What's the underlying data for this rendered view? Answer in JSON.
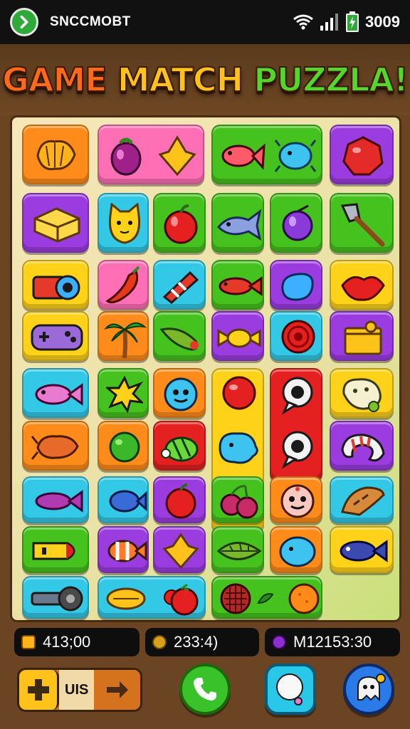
{
  "status_bar": {
    "carrier": "SNCCMOBT",
    "time": "3009"
  },
  "title": {
    "part1": "GAME ",
    "part2": "MATCH ",
    "part3": "PUZZLA!"
  },
  "scores": [
    {
      "value": "413;00",
      "gem_color": "#ffb21a"
    },
    {
      "value": "233:4)",
      "gem_color": "#d9a11a"
    },
    {
      "value": "M12153:30",
      "gem_color": "#8b2fd0"
    }
  ],
  "bottom_bar": {
    "combo_label": "UIS"
  },
  "colors": {
    "orange": "#ff8c1a",
    "pink": "#ff6fb6",
    "green": "#46c21f",
    "purple": "#9b3ce0",
    "cyan": "#33c9e6",
    "yellow": "#ffd21a",
    "red": "#e52020"
  },
  "board_tiles": [
    {
      "color": "orange",
      "item": "seashell-icon"
    },
    {
      "color": "pink",
      "item": "berry-icon"
    },
    {
      "color": "pink",
      "item": "star-gem-icon"
    },
    {
      "color": "green",
      "item": "fish-icon"
    },
    {
      "color": "green",
      "item": "pufferfish-icon"
    },
    {
      "color": "purple",
      "item": "red-gem-icon"
    },
    {
      "color": "purple",
      "item": "gold-block-icon"
    },
    {
      "color": "cyan",
      "item": "cat-face-icon"
    },
    {
      "color": "green",
      "item": "apple-icon"
    },
    {
      "color": "green",
      "item": "whale-icon"
    },
    {
      "color": "green",
      "item": "plum-icon"
    },
    {
      "color": "green",
      "item": "shovel-icon"
    },
    {
      "color": "yellow",
      "item": "camera-icon"
    },
    {
      "color": "pink",
      "item": "chili-icon"
    },
    {
      "color": "cyan",
      "item": "candy-stick-icon"
    },
    {
      "color": "green",
      "item": "fish-red-icon"
    },
    {
      "color": "purple",
      "item": "blue-bean-icon"
    },
    {
      "color": "yellow",
      "item": "red-lips-icon"
    },
    {
      "color": "yellow",
      "item": "gamepad-icon"
    },
    {
      "color": "orange",
      "item": "palm-tree-icon"
    },
    {
      "color": "green",
      "item": "cucumber-icon"
    },
    {
      "color": "purple",
      "item": "candy-icon"
    },
    {
      "color": "cyan",
      "item": "target-icon"
    },
    {
      "color": "purple",
      "item": "treasure-box-icon"
    },
    {
      "color": "cyan",
      "item": "pink-fish-icon"
    },
    {
      "color": "green",
      "item": "spark-icon"
    },
    {
      "color": "orange",
      "item": "blue-face-icon"
    },
    {
      "color": "yellow",
      "item": "red-ball-icon"
    },
    {
      "color": "red",
      "item": "speech-bubble-icon"
    },
    {
      "color": "yellow",
      "item": "cookie-icon"
    },
    {
      "color": "orange",
      "item": "lobster-icon"
    },
    {
      "color": "orange",
      "item": "green-ball-icon"
    },
    {
      "color": "red",
      "item": "green-bug-icon"
    },
    {
      "color": "yellow",
      "item": "blue-blob-icon"
    },
    {
      "color": "red",
      "item": "speech-bubble-icon"
    },
    {
      "color": "purple",
      "item": "striped-shell-icon"
    },
    {
      "color": "cyan",
      "item": "purple-fish-icon"
    },
    {
      "color": "cyan",
      "item": "blue-fish-icon"
    },
    {
      "color": "purple",
      "item": "red-apple-icon"
    },
    {
      "color": "green",
      "item": "cherries-icon"
    },
    {
      "color": "orange",
      "item": "donut-face-icon"
    },
    {
      "color": "cyan",
      "item": "bread-icon"
    },
    {
      "color": "green",
      "item": "rocket-icon"
    },
    {
      "color": "purple",
      "item": "clownfish-icon"
    },
    {
      "color": "purple",
      "item": "gold-star-icon"
    },
    {
      "color": "green",
      "item": "leaf-icon"
    },
    {
      "color": "orange",
      "item": "blue-puffer-icon"
    },
    {
      "color": "yellow",
      "item": "navy-fish-icon"
    },
    {
      "color": "cyan",
      "item": "wheel-tool-icon"
    },
    {
      "color": "cyan",
      "item": "lemon-icon"
    },
    {
      "color": "cyan",
      "item": "tomato-icon"
    },
    {
      "color": "green",
      "item": "waffle-icon"
    },
    {
      "color": "green",
      "item": "orange-icon"
    }
  ]
}
